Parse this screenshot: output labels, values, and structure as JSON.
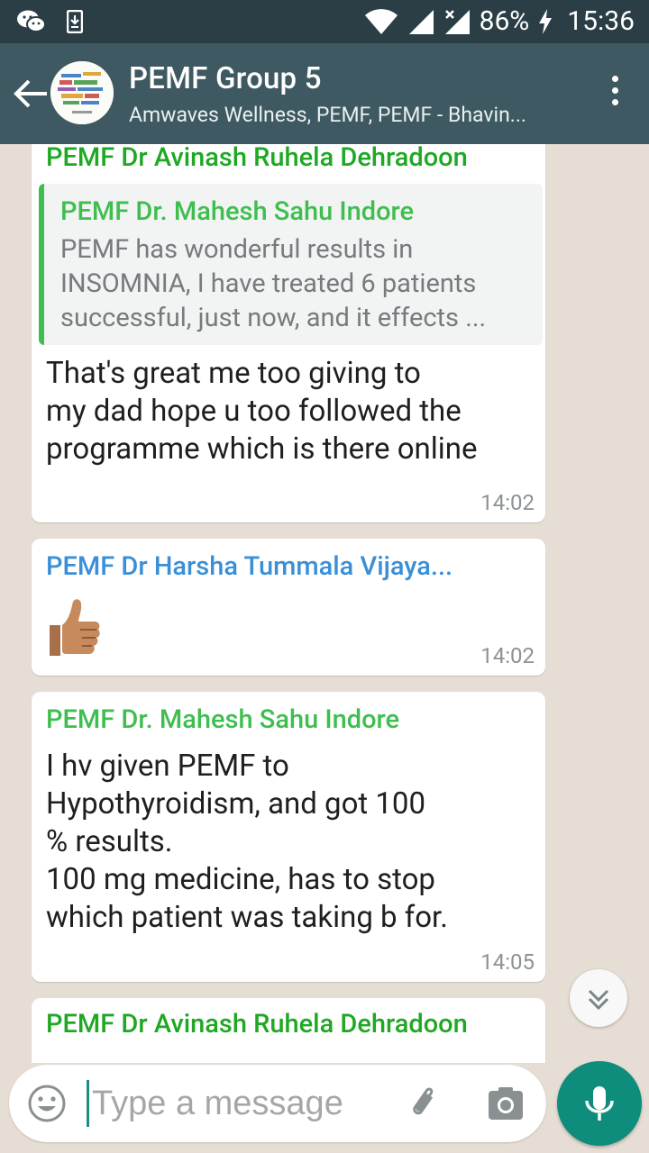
{
  "status_bar": {
    "battery": "86%",
    "time": "15:36"
  },
  "header": {
    "title": "PEMF Group 5",
    "subtitle": "Amwaves Wellness, PEMF, PEMF - Bhavin..."
  },
  "messages": [
    {
      "sender": "PEMF Dr Avinash Ruhela Dehradoon",
      "quote_sender": "PEMF Dr. Mahesh Sahu Indore",
      "quote_text": "PEMF has wonderful results in INSOMNIA, I have treated 6 patients successful, just now, and it effects ...",
      "text": "That's great me too giving to\nmy dad hope u too followed the\nprogramme which is there online",
      "time": "14:02"
    },
    {
      "sender": "PEMF Dr Harsha Tummala Vijaya...",
      "text": "👍",
      "time": "14:02"
    },
    {
      "sender": "PEMF Dr. Mahesh Sahu Indore",
      "text": "I hv given PEMF to\nHypothyroidism, and got 100\n% results.\n100  mg  medicine, has to stop\nwhich patient was taking b for.",
      "time": "14:05"
    },
    {
      "sender": "PEMF Dr Avinash Ruhela Dehradoon"
    }
  ],
  "input": {
    "placeholder": "Type a message"
  },
  "colors": {
    "appbar": "#3e5961",
    "green_sender": "#3fbe4f",
    "blue_sender": "#3a8fd6",
    "accent": "#0f8d7c"
  }
}
